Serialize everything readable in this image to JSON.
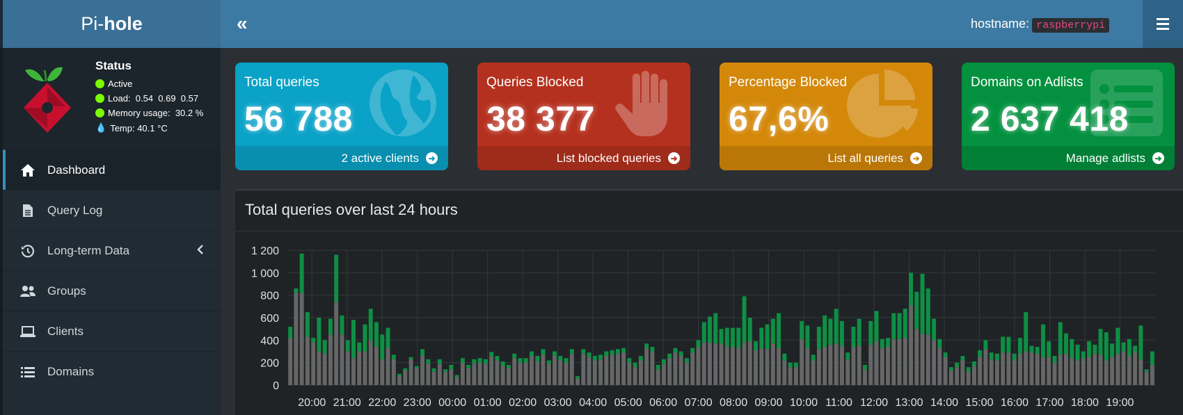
{
  "header": {
    "logo_pre": "Pi-",
    "logo_bold": "hole",
    "toggle_icon": "«",
    "hostname_label": "hostname:",
    "hostname_value": "raspberrypi"
  },
  "status": {
    "title": "Status",
    "active": "Active",
    "load": "Load:  0.54  0.69  0.57",
    "memory": "Memory usage:  30.2 %",
    "temp": "Temp: 40.1 °C",
    "colors": {
      "ok": "#7cfc00",
      "temp": "#3d8ee0"
    }
  },
  "nav": [
    {
      "label": "Dashboard",
      "icon": "home-icon"
    },
    {
      "label": "Query Log",
      "icon": "file-icon"
    },
    {
      "label": "Long-term Data",
      "icon": "history-icon"
    },
    {
      "label": "Groups",
      "icon": "users-icon"
    },
    {
      "label": "Clients",
      "icon": "laptop-icon"
    },
    {
      "label": "Domains",
      "icon": "list-icon"
    }
  ],
  "boxes": [
    {
      "label": "Total queries",
      "value": "56 788",
      "footer": "2 active clients",
      "color": "#0aa2c7",
      "icon": "globe-icon"
    },
    {
      "label": "Queries Blocked",
      "value": "38 377",
      "footer": "List blocked queries",
      "color": "#b5311f",
      "icon": "hand-icon"
    },
    {
      "label": "Percentage Blocked",
      "value": "67,6%",
      "footer": "List all queries",
      "color": "#d4880a",
      "icon": "pie-chart-icon"
    },
    {
      "label": "Domains on Adlists",
      "value": "2 637 418",
      "footer": "Manage adlists",
      "color": "#03913f",
      "icon": "list-icon"
    }
  ],
  "chart_title": "Total queries over last 24 hours",
  "chart_data": {
    "type": "bar",
    "stacked": true,
    "ylim": [
      0,
      1200
    ],
    "yticks": [
      "0",
      "200",
      "400",
      "600",
      "800",
      "1 000",
      "1 200"
    ],
    "xticks": [
      "20:00",
      "21:00",
      "22:00",
      "23:00",
      "00:00",
      "01:00",
      "02:00",
      "03:00",
      "04:00",
      "05:00",
      "06:00",
      "07:00",
      "08:00",
      "09:00",
      "10:00",
      "11:00",
      "12:00",
      "13:00",
      "14:00",
      "15:00",
      "16:00",
      "17:00",
      "18:00",
      "19:00"
    ],
    "grid": true,
    "colors": {
      "permitted": "#666666",
      "blocked": "#0e8f44"
    },
    "total": [
      520,
      860,
      1170,
      650,
      420,
      600,
      400,
      590,
      1160,
      620,
      400,
      580,
      380,
      540,
      680,
      560,
      450,
      510,
      270,
      100,
      150,
      250,
      170,
      320,
      230,
      150,
      230,
      140,
      180,
      90,
      240,
      180,
      230,
      240,
      230,
      295,
      260,
      210,
      180,
      280,
      240,
      240,
      300,
      260,
      320,
      220,
      300,
      260,
      240,
      320,
      80,
      320,
      290,
      260,
      270,
      300,
      310,
      320,
      330,
      240,
      200,
      260,
      370,
      340,
      180,
      230,
      280,
      330,
      300,
      240,
      330,
      400,
      560,
      610,
      640,
      500,
      510,
      510,
      510,
      790,
      600,
      390,
      510,
      540,
      590,
      640,
      280,
      200,
      200,
      570,
      530,
      270,
      520,
      620,
      590,
      680,
      570,
      290,
      520,
      590,
      180,
      570,
      660,
      410,
      420,
      640,
      640,
      680,
      1000,
      830,
      990,
      860,
      590,
      410,
      290,
      160,
      200,
      260,
      160,
      210,
      310,
      400,
      290,
      280,
      430,
      430,
      280,
      420,
      650,
      350,
      340,
      540,
      390,
      260,
      560,
      460,
      410,
      360,
      300,
      390,
      360,
      500,
      470,
      370,
      510,
      380,
      410,
      350,
      530,
      140,
      300
    ],
    "blocked": [
      100,
      40,
      350,
      220,
      40,
      300,
      120,
      140,
      420,
      170,
      100,
      340,
      80,
      240,
      280,
      220,
      220,
      180,
      40,
      20,
      20,
      20,
      20,
      60,
      40,
      30,
      40,
      20,
      40,
      20,
      40,
      30,
      40,
      40,
      40,
      40,
      40,
      40,
      30,
      40,
      40,
      40,
      40,
      50,
      50,
      30,
      40,
      40,
      40,
      40,
      20,
      40,
      40,
      40,
      40,
      40,
      40,
      40,
      40,
      40,
      40,
      40,
      40,
      40,
      40,
      40,
      40,
      40,
      40,
      40,
      40,
      60,
      180,
      230,
      270,
      130,
      170,
      170,
      180,
      410,
      210,
      80,
      180,
      220,
      220,
      310,
      60,
      40,
      40,
      160,
      200,
      50,
      200,
      280,
      230,
      310,
      220,
      60,
      180,
      240,
      40,
      210,
      270,
      80,
      80,
      230,
      230,
      260,
      290,
      330,
      530,
      410,
      190,
      80,
      40,
      30,
      40,
      40,
      40,
      40,
      60,
      80,
      60,
      60,
      140,
      140,
      60,
      140,
      350,
      60,
      60,
      290,
      140,
      60,
      290,
      180,
      170,
      140,
      60,
      140,
      80,
      230,
      250,
      120,
      230,
      80,
      150,
      60,
      300,
      20,
      120
    ]
  }
}
